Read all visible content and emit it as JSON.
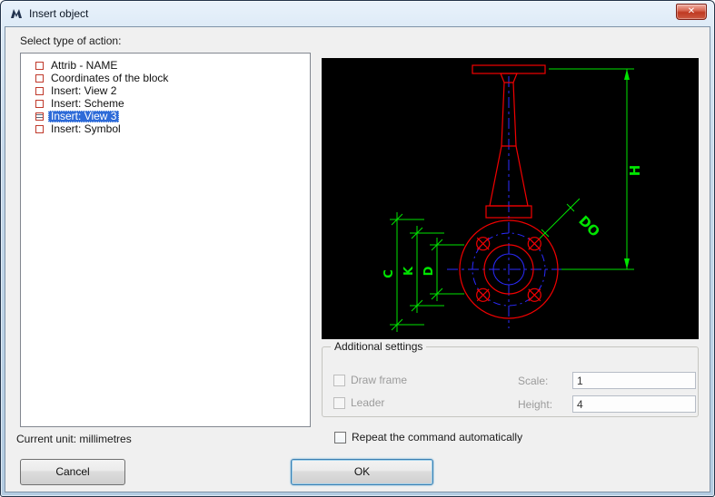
{
  "window": {
    "title": "Insert object",
    "close_glyph": "✕"
  },
  "labels": {
    "select_type": "Select type of action:",
    "current_unit": "Current unit: millimetres",
    "repeat": "Repeat the command automatically"
  },
  "action_list": {
    "selected_index": 4,
    "items": [
      {
        "label": "Attrib - NAME"
      },
      {
        "label": "Coordinates of the block"
      },
      {
        "label": "Insert: View 2"
      },
      {
        "label": "Insert: Scheme"
      },
      {
        "label": "Insert: View 3"
      },
      {
        "label": "Insert: Symbol"
      }
    ]
  },
  "additional_settings": {
    "title": "Additional settings",
    "draw_frame": "Draw frame",
    "leader": "Leader",
    "scale_label": "Scale:",
    "scale_value": "1",
    "height_label": "Height:",
    "height_value": "4"
  },
  "buttons": {
    "ok": "OK",
    "cancel": "Cancel"
  },
  "preview": {
    "background": "#000000",
    "drawing_color": "#f20000",
    "dimension_color": "#00e400",
    "centerline_color": "#2b2bff",
    "dims": {
      "h": "H",
      "do": "DO",
      "c": "C",
      "k": "K",
      "d": "D"
    }
  }
}
